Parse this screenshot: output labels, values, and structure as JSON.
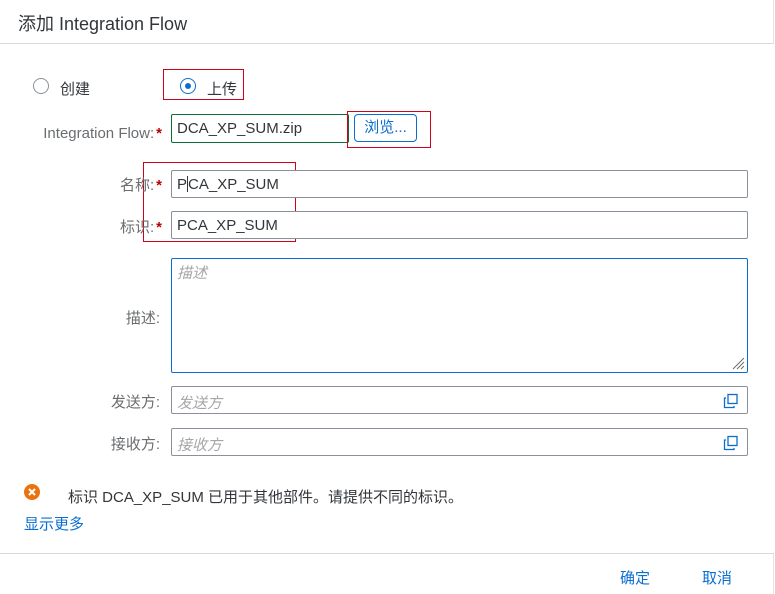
{
  "dialog": {
    "title": "添加 Integration Flow"
  },
  "mode": {
    "options": [
      {
        "label": "创建",
        "selected": false
      },
      {
        "label": "上传",
        "selected": true
      }
    ]
  },
  "form": {
    "file": {
      "label": "Integration Flow:",
      "required_mark": "*",
      "value": "DCA_XP_SUM.zip",
      "browse_label": "浏览..."
    },
    "name": {
      "label": "名称:",
      "required_mark": "*",
      "value_before_caret": "P",
      "value_after_caret": "CA_XP_SUM"
    },
    "id": {
      "label": "标识:",
      "required_mark": "*",
      "value": "PCA_XP_SUM"
    },
    "description": {
      "label": "描述:",
      "placeholder": "描述"
    },
    "sender": {
      "label": "发送方:",
      "placeholder": "发送方",
      "icon": "value-help-icon"
    },
    "receiver": {
      "label": "接收方:",
      "placeholder": "接收方",
      "icon": "value-help-icon"
    }
  },
  "message": {
    "type": "error",
    "icon": "error-icon",
    "text": "标识 DCA_XP_SUM 已用于其他部件。请提供不同的标识。",
    "show_more": "显示更多"
  },
  "footer": {
    "ok_label": "确定",
    "cancel_label": "取消"
  },
  "colors": {
    "accent": "#0a6ed1",
    "error": "#e9730c",
    "required": "#bb0000",
    "highlight": "#d0021b"
  }
}
